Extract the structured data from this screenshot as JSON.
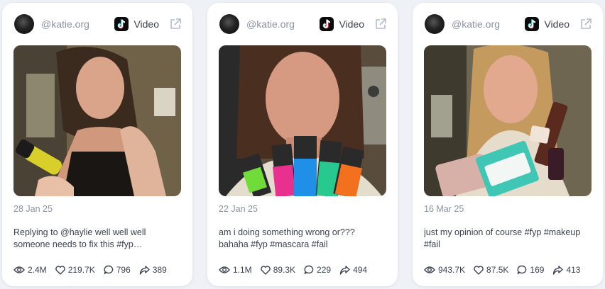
{
  "posts": [
    {
      "handle": "@katie.org",
      "platform_label": "Video",
      "date": "28 Jan 25",
      "caption": "Replying to @haylie well well well someone needs to fix this #fyp…",
      "views": "2.4M",
      "likes": "219.7K",
      "comments": "796",
      "shares": "389"
    },
    {
      "handle": "@katie.org",
      "platform_label": "Video",
      "date": "22 Jan 25",
      "caption": "am i doing something wrong or??? bahaha #fyp #mascara #fail",
      "views": "1.1M",
      "likes": "89.3K",
      "comments": "229",
      "shares": "494"
    },
    {
      "handle": "@katie.org",
      "platform_label": "Video",
      "date": "16 Mar 25",
      "caption": "just my opinion of course #fyp #makeup #fail",
      "views": "943.7K",
      "likes": "87.5K",
      "comments": "169",
      "shares": "413"
    }
  ],
  "icons": {
    "platform": "tiktok-icon",
    "external": "external-link-icon",
    "views": "eye-icon",
    "likes": "heart-icon",
    "comments": "comment-icon",
    "shares": "share-icon"
  },
  "colors": {
    "background": "#eef1f6",
    "card": "#ffffff",
    "muted_text": "#8a92a3",
    "body_text": "#3b4150"
  }
}
